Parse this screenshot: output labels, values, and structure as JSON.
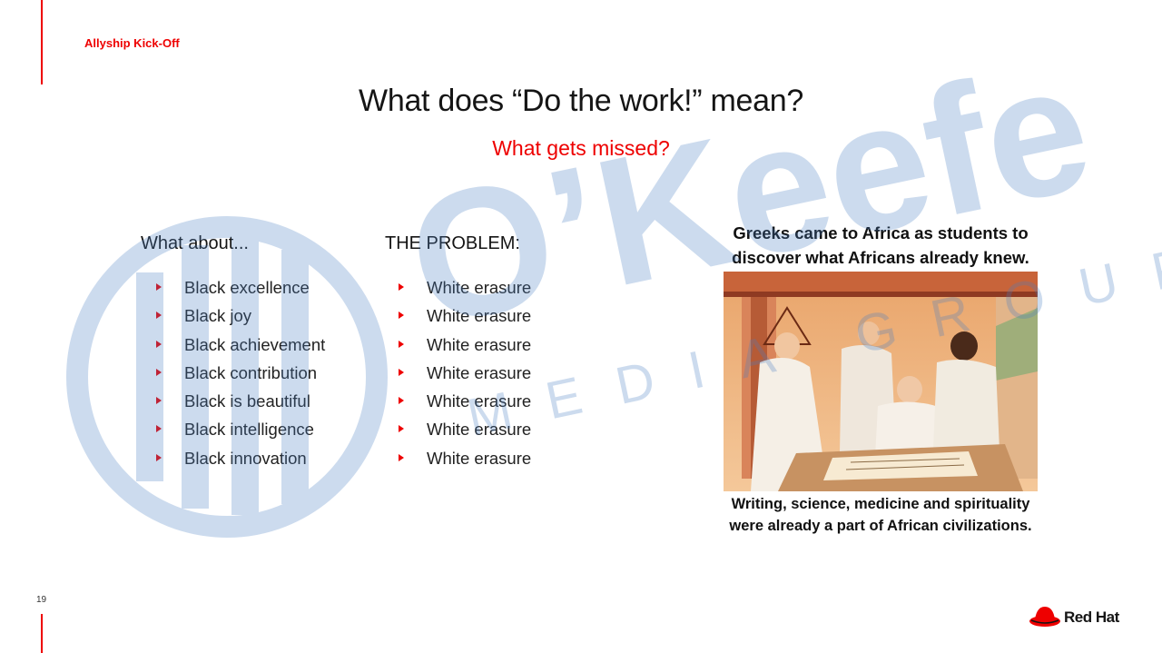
{
  "header": {
    "deck_label": "Allyship Kick-Off",
    "page_number": "19"
  },
  "slide": {
    "title": "What does “Do the work!” mean?",
    "subtitle": "What gets missed?"
  },
  "left_column": {
    "heading": "What about...",
    "items": [
      "Black excellence",
      "Black joy",
      "Black achievement",
      "Black contribution",
      "Black is beautiful",
      "Black intelligence",
      "Black innovation"
    ]
  },
  "middle_column": {
    "heading": "THE PROBLEM:",
    "items": [
      "White erasure",
      "White erasure",
      "White erasure",
      "White erasure",
      "White erasure",
      "White erasure",
      "White erasure"
    ]
  },
  "meme": {
    "caption_top": "Greeks came to Africa as students to discover what Africans already knew.",
    "caption_bottom": "Writing, science, medicine and spirituality were already a part of African civilizations."
  },
  "watermark": {
    "brand": "O’Keefe",
    "subline": "MEDIA GROUP"
  },
  "footer": {
    "logo_text": "Red Hat"
  },
  "colors": {
    "accent": "#ee0000",
    "watermark": "#4a7fc1"
  }
}
